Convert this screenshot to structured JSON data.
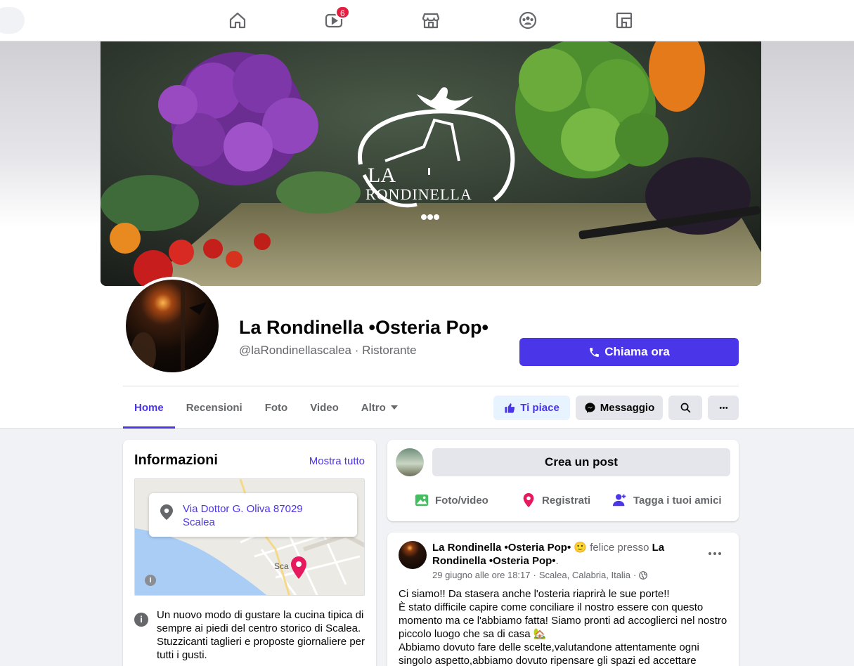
{
  "nav": {
    "home_label": "",
    "watch_badge": "6"
  },
  "page": {
    "name": "La Rondinella •Osteria Pop•",
    "handle": "@laRondinellascalea",
    "separator": "·",
    "category": "Ristorante",
    "cover_logo_line1": "LA",
    "cover_logo_line2": "RONDINELLA",
    "call_label": "Chiama ora"
  },
  "tabs": [
    {
      "label": "Home"
    },
    {
      "label": "Recensioni"
    },
    {
      "label": "Foto"
    },
    {
      "label": "Video"
    },
    {
      "label": "Altro"
    }
  ],
  "actions": {
    "like_label": "Ti piace",
    "message_label": "Messaggio"
  },
  "info": {
    "title": "Informazioni",
    "show_all": "Mostra tutto",
    "address_line1": "Via Dottor G. Oliva 87029",
    "address_line2": "Scalea",
    "map_town": "Sca",
    "description": "Un nuovo modo di gustare la cucina tipica di sempre ai piedi del centro storico di Scalea. Stuzzicanti taglieri e proposte giornaliere per tutti i gusti."
  },
  "composer": {
    "create_label": "Crea un post",
    "photo_label": "Foto/video",
    "checkin_label": "Registrati",
    "tag_label": "Tagga i tuoi amici"
  },
  "post": {
    "author": "La Rondinella •Osteria Pop•",
    "feeling": "felice presso",
    "place": "La Rondinella •Osteria Pop•",
    "date": "29 giugno alle ore 18:17",
    "location": "Scalea, Calabria, Italia",
    "body_line1": "Ci siamo!! Da stasera anche l'osteria riaprirà le sue porte!!",
    "body_line2": "È stato difficile capire come conciliare il nostro essere con questo momento ma ce l'abbiamo fatta! Siamo pronti ad accoglierci nel nostro piccolo luogo che sa di casa 🏡",
    "body_line3": "Abbiamo dovuto fare delle scelte,valutandone attentamente ogni singolo aspetto,abbiamo dovuto ripensare gli spazi ed accettare"
  },
  "colors": {
    "accent": "#4b35e8",
    "badge": "#e41e3f",
    "pin": "#e6195e"
  }
}
